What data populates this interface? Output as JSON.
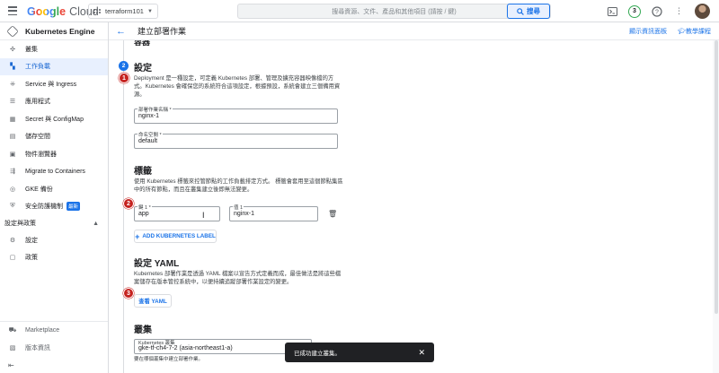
{
  "topbar": {
    "logo_google": "Google",
    "logo_cloud": "Cloud",
    "project": "terraform101",
    "search_placeholder": "搜尋資源、文件、產品和其他項目 (請按 / 鍵)",
    "search_button": "搜尋",
    "notification_count": "3"
  },
  "sidebar": {
    "title": "Kubernetes Engine",
    "items": [
      {
        "label": "叢集",
        "icon": "cluster-icon"
      },
      {
        "label": "工作負載",
        "icon": "workloads-icon"
      },
      {
        "label": "Service 與 Ingress",
        "icon": "services-icon"
      },
      {
        "label": "應用程式",
        "icon": "applications-icon"
      },
      {
        "label": "Secret 與 ConfigMap",
        "icon": "secrets-icon"
      },
      {
        "label": "儲存空間",
        "icon": "storage-icon"
      },
      {
        "label": "物件瀏覽器",
        "icon": "object-browser-icon"
      },
      {
        "label": "Migrate to Containers",
        "icon": "migrate-icon"
      },
      {
        "label": "GKE 備份",
        "icon": "backup-icon"
      },
      {
        "label": "安全防護機制",
        "icon": "security-icon",
        "badge": "最新"
      }
    ],
    "section": "設定與政策",
    "section_items": [
      {
        "label": "設定",
        "icon": "settings-icon"
      },
      {
        "label": "政策",
        "icon": "policy-icon"
      }
    ],
    "bottom_items": [
      {
        "label": "Marketplace",
        "icon": "marketplace-icon"
      },
      {
        "label": "版本資訊",
        "icon": "release-notes-icon"
      }
    ]
  },
  "header": {
    "title": "建立部署作業",
    "show_info_panel": "顯示資訊面板",
    "tutorial": "教學課程"
  },
  "form": {
    "prev_step_title_cut": "容器",
    "step_number": "2",
    "config_title": "設定",
    "config_desc": "Deployment 是一種設定，可定義 Kubernetes 部署、管理及擴充容器映像檔的方式。Kubernetes 會確保您的系統符合這項設定，根據預設，系統會建立三個備用資源。",
    "name_label": "部署作業名稱 *",
    "name_value": "nginx-1",
    "namespace_label": "命名空間 *",
    "namespace_value": "default",
    "labels_title": "標籤",
    "labels_desc": "使用 Kubernetes 標籤來控管節點的工作負載排定方式。 標籤會套用至這個節點集區中的所有節點，而且在叢集建立後即無法變更。",
    "key_label": "鍵 1 *",
    "key_value": "app",
    "value_label": "值 1",
    "value_value": "nginx-1",
    "add_label_button": "ADD KUBERNETES LABEL",
    "yaml_title": "設定 YAML",
    "yaml_desc": "Kubernetes 部署作業是透過 YAML 檔案以宣告方式定義而成，最佳做法是將這些檔案儲存在版本管控系統中，以便持續追蹤部署作業設定的變更。",
    "view_yaml_button": "查看 YAML",
    "cluster_title": "叢集",
    "cluster_label": "Kubernetes 叢集",
    "cluster_value": "gke-tf-ch4-7-2 (asia-northeast1-a)",
    "cluster_hint": "要在哪個叢集中建立部署作業。"
  },
  "callouts": [
    "1",
    "2",
    "3"
  ],
  "toast": {
    "message": "已成功建立叢集。"
  }
}
